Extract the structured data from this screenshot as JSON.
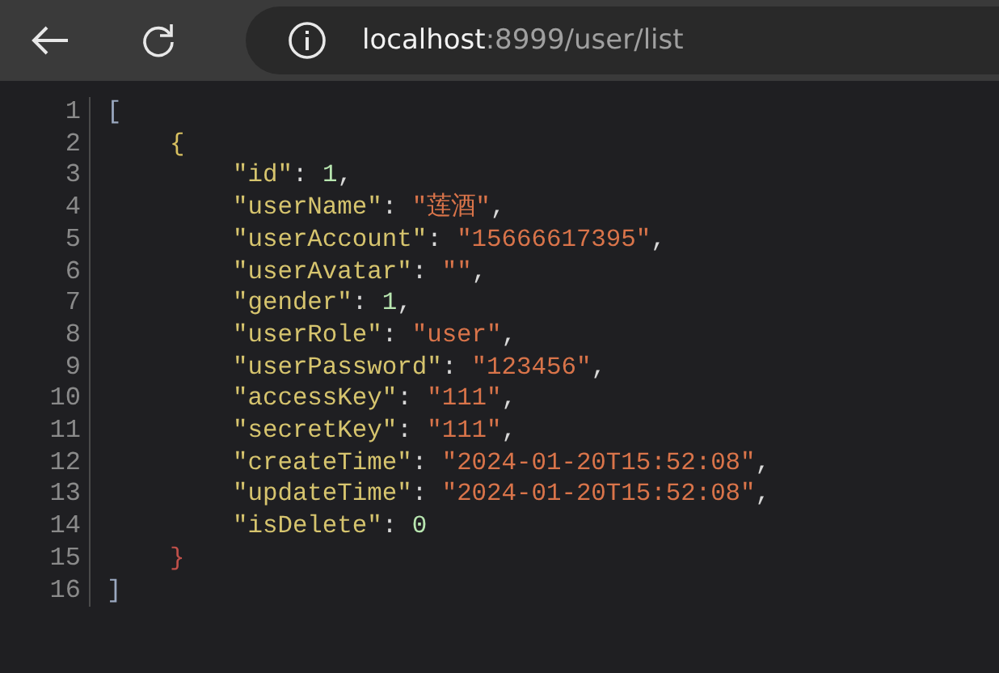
{
  "toolbar": {
    "address": {
      "host": "localhost",
      "rest": ":8999/user/list"
    }
  },
  "code": {
    "lines": [
      {
        "number": "1",
        "tokens": [
          {
            "kind": "bracket",
            "text": "[",
            "color": "#9aa8c0"
          }
        ],
        "children": [
          {
            "number": "2",
            "tokens": [
              {
                "kind": "bracket",
                "text": "{",
                "color": "#d8c060"
              }
            ],
            "children": [
              {
                "number": "3",
                "tokens": [
                  {
                    "kind": "key",
                    "text": "\"id\""
                  },
                  {
                    "kind": "punct",
                    "text": ": "
                  },
                  {
                    "kind": "number",
                    "text": "1"
                  },
                  {
                    "kind": "punct",
                    "text": ","
                  }
                ]
              },
              {
                "number": "4",
                "tokens": [
                  {
                    "kind": "key",
                    "text": "\"userName\""
                  },
                  {
                    "kind": "punct",
                    "text": ": "
                  },
                  {
                    "kind": "string",
                    "text": "\"莲酒\""
                  },
                  {
                    "kind": "punct",
                    "text": ","
                  }
                ]
              },
              {
                "number": "5",
                "tokens": [
                  {
                    "kind": "key",
                    "text": "\"userAccount\""
                  },
                  {
                    "kind": "punct",
                    "text": ": "
                  },
                  {
                    "kind": "string",
                    "text": "\"15666617395\""
                  },
                  {
                    "kind": "punct",
                    "text": ","
                  }
                ]
              },
              {
                "number": "6",
                "tokens": [
                  {
                    "kind": "key",
                    "text": "\"userAvatar\""
                  },
                  {
                    "kind": "punct",
                    "text": ": "
                  },
                  {
                    "kind": "string",
                    "text": "\"\""
                  },
                  {
                    "kind": "punct",
                    "text": ","
                  }
                ]
              },
              {
                "number": "7",
                "tokens": [
                  {
                    "kind": "key",
                    "text": "\"gender\""
                  },
                  {
                    "kind": "punct",
                    "text": ": "
                  },
                  {
                    "kind": "number",
                    "text": "1"
                  },
                  {
                    "kind": "punct",
                    "text": ","
                  }
                ]
              },
              {
                "number": "8",
                "tokens": [
                  {
                    "kind": "key",
                    "text": "\"userRole\""
                  },
                  {
                    "kind": "punct",
                    "text": ": "
                  },
                  {
                    "kind": "string",
                    "text": "\"user\""
                  },
                  {
                    "kind": "punct",
                    "text": ","
                  }
                ]
              },
              {
                "number": "9",
                "tokens": [
                  {
                    "kind": "key",
                    "text": "\"userPassword\""
                  },
                  {
                    "kind": "punct",
                    "text": ": "
                  },
                  {
                    "kind": "string",
                    "text": "\"123456\""
                  },
                  {
                    "kind": "punct",
                    "text": ","
                  }
                ]
              },
              {
                "number": "10",
                "tokens": [
                  {
                    "kind": "key",
                    "text": "\"accessKey\""
                  },
                  {
                    "kind": "punct",
                    "text": ": "
                  },
                  {
                    "kind": "string",
                    "text": "\"111\""
                  },
                  {
                    "kind": "punct",
                    "text": ","
                  }
                ]
              },
              {
                "number": "11",
                "tokens": [
                  {
                    "kind": "key",
                    "text": "\"secretKey\""
                  },
                  {
                    "kind": "punct",
                    "text": ": "
                  },
                  {
                    "kind": "string",
                    "text": "\"111\""
                  },
                  {
                    "kind": "punct",
                    "text": ","
                  }
                ]
              },
              {
                "number": "12",
                "tokens": [
                  {
                    "kind": "key",
                    "text": "\"createTime\""
                  },
                  {
                    "kind": "punct",
                    "text": ": "
                  },
                  {
                    "kind": "string",
                    "text": "\"2024-01-20T15:52:08\""
                  },
                  {
                    "kind": "punct",
                    "text": ","
                  }
                ]
              },
              {
                "number": "13",
                "tokens": [
                  {
                    "kind": "key",
                    "text": "\"updateTime\""
                  },
                  {
                    "kind": "punct",
                    "text": ": "
                  },
                  {
                    "kind": "string",
                    "text": "\"2024-01-20T15:52:08\""
                  },
                  {
                    "kind": "punct",
                    "text": ","
                  }
                ]
              },
              {
                "number": "14",
                "tokens": [
                  {
                    "kind": "key",
                    "text": "\"isDelete\""
                  },
                  {
                    "kind": "punct",
                    "text": ": "
                  },
                  {
                    "kind": "number",
                    "text": "0"
                  }
                ]
              }
            ]
          },
          {
            "number": "15",
            "tokens": [
              {
                "kind": "bracket",
                "text": "}",
                "color": "#c0504a"
              }
            ]
          }
        ]
      },
      {
        "number": "16",
        "tokens": [
          {
            "kind": "bracket",
            "text": "]",
            "color": "#9aa8c0"
          }
        ]
      }
    ]
  }
}
